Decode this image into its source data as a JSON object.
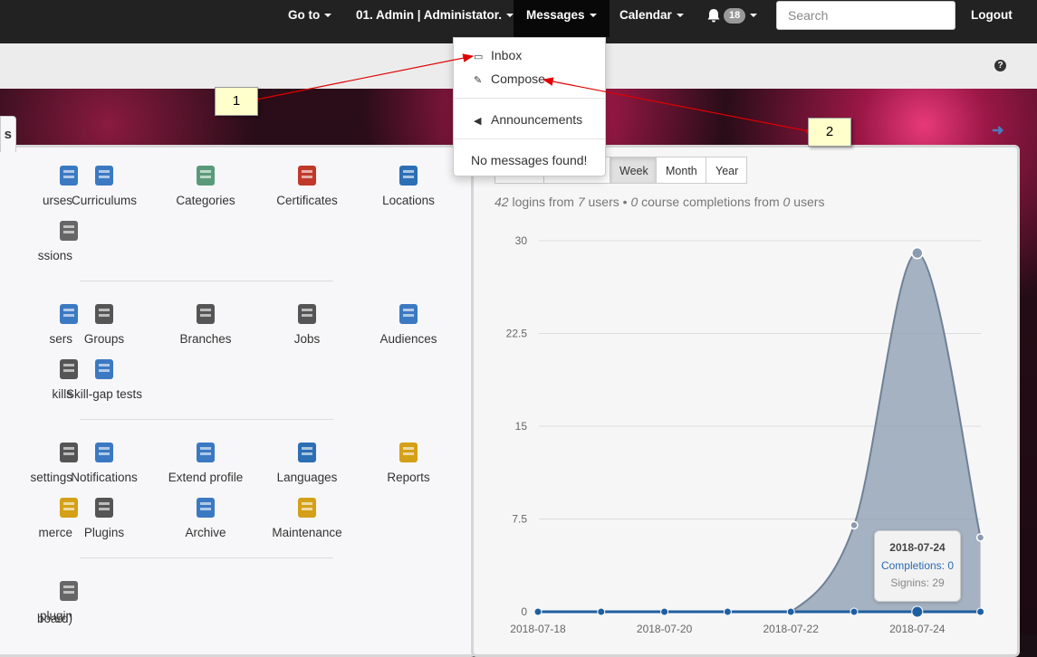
{
  "topnav": {
    "goto_label": "Go to",
    "user_label": "01. Admin | Administator.",
    "messages_label": "Messages",
    "calendar_label": "Calendar",
    "notification_count": "18",
    "search_placeholder": "Search",
    "logout_label": "Logout"
  },
  "messages_menu": {
    "items": [
      {
        "label": "Inbox",
        "icon": "inbox-icon"
      },
      {
        "label": "Compose",
        "icon": "compose-icon"
      },
      {
        "label": "Announcements",
        "icon": "megaphone-icon"
      }
    ],
    "empty_text": "No messages found!"
  },
  "callouts": [
    "1",
    "2"
  ],
  "left_panel": {
    "tab_label": "s",
    "tiles": [
      {
        "label": "urses",
        "icon": "courses-icon"
      },
      {
        "label": "Curriculums",
        "icon": "curriculums-icon"
      },
      {
        "label": "Categories",
        "icon": "categories-icon"
      },
      {
        "label": "Certificates",
        "icon": "certificate-icon"
      },
      {
        "label": "Locations",
        "icon": "globe-pin-icon"
      },
      {
        "label": "ssions",
        "icon": "discussions-icon"
      },
      {
        "label": "sers",
        "icon": "users-icon"
      },
      {
        "label": "Groups",
        "icon": "groups-icon"
      },
      {
        "label": "Branches",
        "icon": "branches-icon"
      },
      {
        "label": "Jobs",
        "icon": "jobs-icon"
      },
      {
        "label": "Audiences",
        "icon": "audiences-icon"
      },
      {
        "label": "kills",
        "icon": "skills-icon"
      },
      {
        "label": "Skill-gap tests",
        "icon": "skill-gap-test-icon"
      },
      {
        "label": " settings",
        "icon": "settings-tools-icon"
      },
      {
        "label": "Notifications",
        "icon": "notifications-icon"
      },
      {
        "label": "Extend profile",
        "icon": "extend-profile-icon"
      },
      {
        "label": "Languages",
        "icon": "languages-icon"
      },
      {
        "label": "Reports",
        "icon": "reports-icon"
      },
      {
        "label": "merce",
        "icon": "ecommerce-icon"
      },
      {
        "label": "Plugins",
        "icon": "plugin-icon"
      },
      {
        "label": "Archive",
        "icon": "archive-icon"
      },
      {
        "label": "Maintenance",
        "icon": "maintenance-icon"
      },
      {
        "label": " plugin",
        "icon": "gear-icon"
      },
      {
        "label": "board)",
        "icon": ""
      }
    ]
  },
  "right_panel": {
    "periods": [
      "Week",
      "Month",
      "Year"
    ],
    "active_period": "Week",
    "summary": {
      "logins": "42",
      "logins_text": " logins from ",
      "users": "7",
      "users_text": " users • ",
      "completions": "0",
      "completions_text": " course completions from ",
      "completion_users": "0",
      "completion_users_text": " users"
    },
    "tooltip": {
      "date": "2018-07-24",
      "completions": "Completions: 0",
      "signins": "Signins: 29"
    }
  },
  "chart_data": {
    "type": "area",
    "x": [
      "2018-07-18",
      "2018-07-19",
      "2018-07-20",
      "2018-07-21",
      "2018-07-22",
      "2018-07-23",
      "2018-07-24",
      "2018-07-25"
    ],
    "xticks": [
      "2018-07-18",
      "2018-07-20",
      "2018-07-22",
      "2018-07-24"
    ],
    "yticks": [
      "0",
      "7.5",
      "15",
      "22.5",
      "30"
    ],
    "ylim": [
      0,
      30
    ],
    "series": [
      {
        "name": "Signins",
        "values": [
          0,
          0,
          0,
          0,
          0,
          7,
          29,
          6
        ],
        "color": "#8a9bb0"
      },
      {
        "name": "Completions",
        "values": [
          0,
          0,
          0,
          0,
          0,
          0,
          0,
          0
        ],
        "color": "#1f5fa0"
      }
    ],
    "grid": true
  }
}
